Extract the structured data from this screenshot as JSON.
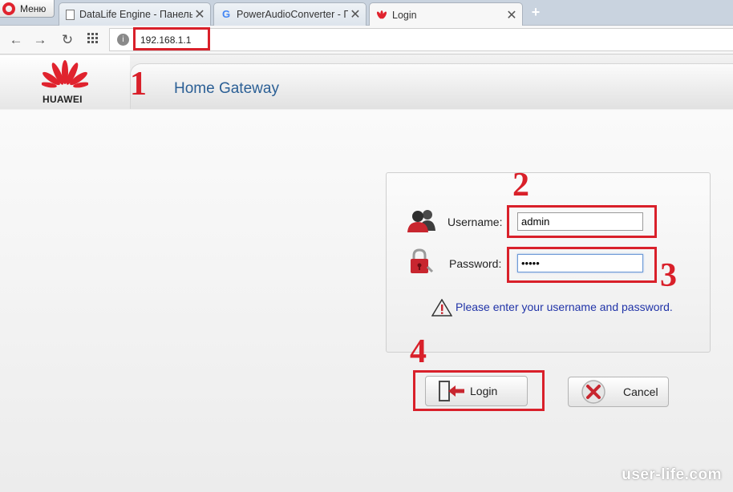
{
  "browser": {
    "menu_label": "Меню",
    "tabs": [
      {
        "title": "DataLife Engine - Панель",
        "active": false
      },
      {
        "title": "PowerAudioConverter - По",
        "active": false
      },
      {
        "title": "Login",
        "active": true
      }
    ],
    "close_glyph": "✕",
    "new_tab_glyph": "+",
    "address": "192.168.1.1"
  },
  "header": {
    "brand": "HUAWEI",
    "title": "Home Gateway"
  },
  "login": {
    "username_label": "Username:",
    "username_value": "admin",
    "password_label": "Password:",
    "password_value": "•••••",
    "hint": "Please enter your username and password.",
    "login_button": "Login",
    "cancel_button": "Cancel"
  },
  "annotations": {
    "num1": "1",
    "num2": "2",
    "num3": "3",
    "num4": "4",
    "color": "#d9202a"
  },
  "watermark": "user-life.com"
}
